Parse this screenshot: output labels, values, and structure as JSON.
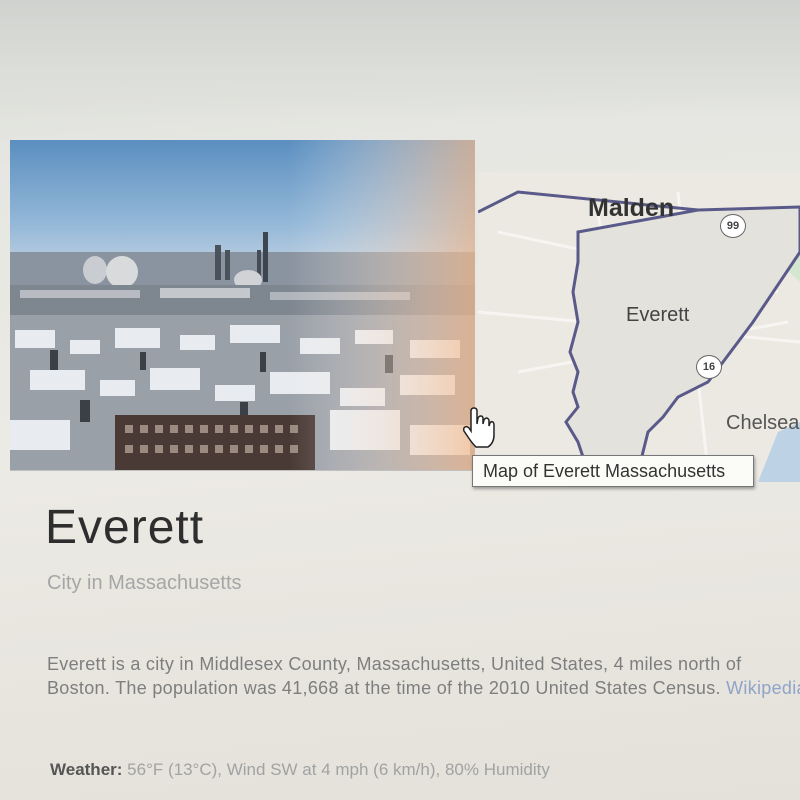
{
  "map": {
    "labels": {
      "malden": "Malden",
      "everett": "Everett",
      "chelsea": "Chelsea"
    },
    "shields": {
      "route_99": "99",
      "route_16": "16"
    },
    "tooltip": "Map of Everett Massachusetts"
  },
  "entity": {
    "title": "Everett",
    "subtitle": "City in Massachusetts",
    "description": "Everett is a city in Middlesex County, Massachusetts, United States, 4 miles north of Boston. The population was 41,668 at the time of the 2010 United States Census.",
    "source_link": "Wikipedia"
  },
  "weather": {
    "label": "Weather:",
    "value": "56°F (13°C), Wind SW at 4 mph (6 km/h), 80% Humidity"
  },
  "colors": {
    "map_boundary": "#5a5a8a",
    "link": "#8fa4c8",
    "map_water": "#9fc3e8"
  }
}
